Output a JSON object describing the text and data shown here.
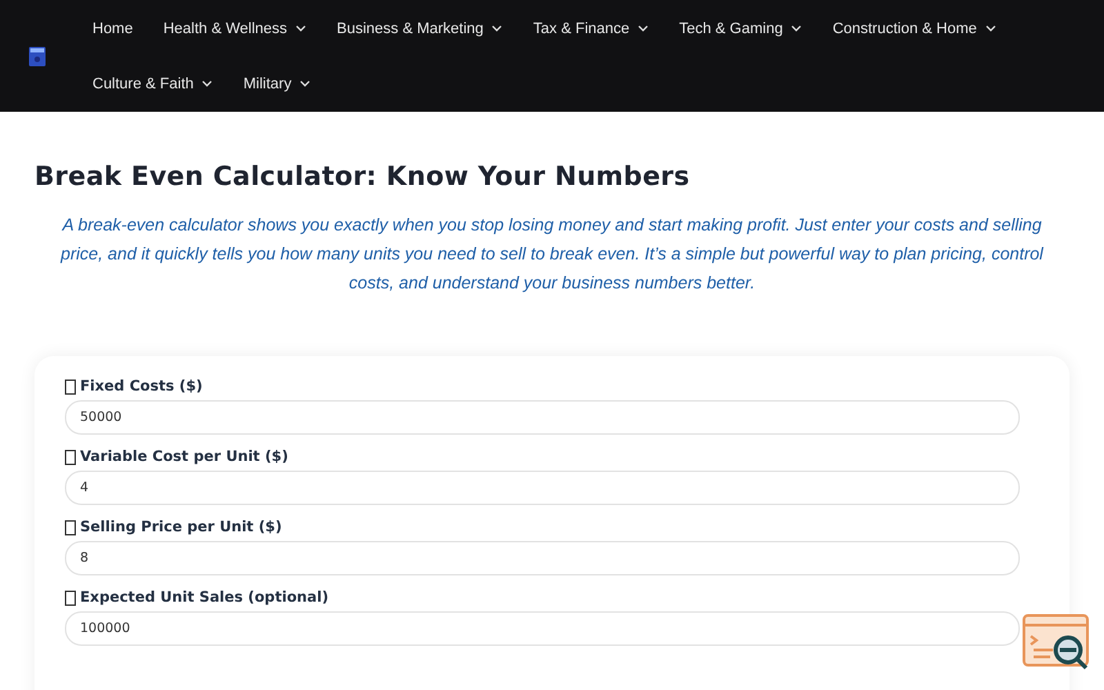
{
  "nav": {
    "items": [
      {
        "label": "Home",
        "dropdown": false
      },
      {
        "label": "Health & Wellness",
        "dropdown": true
      },
      {
        "label": "Business & Marketing",
        "dropdown": true
      },
      {
        "label": "Tax & Finance",
        "dropdown": true
      },
      {
        "label": "Tech & Gaming",
        "dropdown": true
      },
      {
        "label": "Construction & Home",
        "dropdown": true
      },
      {
        "label": "Culture & Faith",
        "dropdown": true
      },
      {
        "label": "Military",
        "dropdown": true
      }
    ]
  },
  "page": {
    "title": "Break Even Calculator: Know Your Numbers",
    "intro": "A break-even calculator shows you exactly when you stop losing money and start making profit. Just enter your costs and selling price, and it quickly tells you how many units you need to sell to break even. It’s a simple but powerful way to plan pricing, control costs, and understand your business numbers better."
  },
  "form": {
    "fields": [
      {
        "label": "Fixed Costs ($)",
        "value": "50000"
      },
      {
        "label": "Variable Cost per Unit ($)",
        "value": "4"
      },
      {
        "label": "Selling Price per Unit ($)",
        "value": "8"
      },
      {
        "label": "Expected Unit Sales (optional)",
        "value": "100000"
      }
    ]
  }
}
